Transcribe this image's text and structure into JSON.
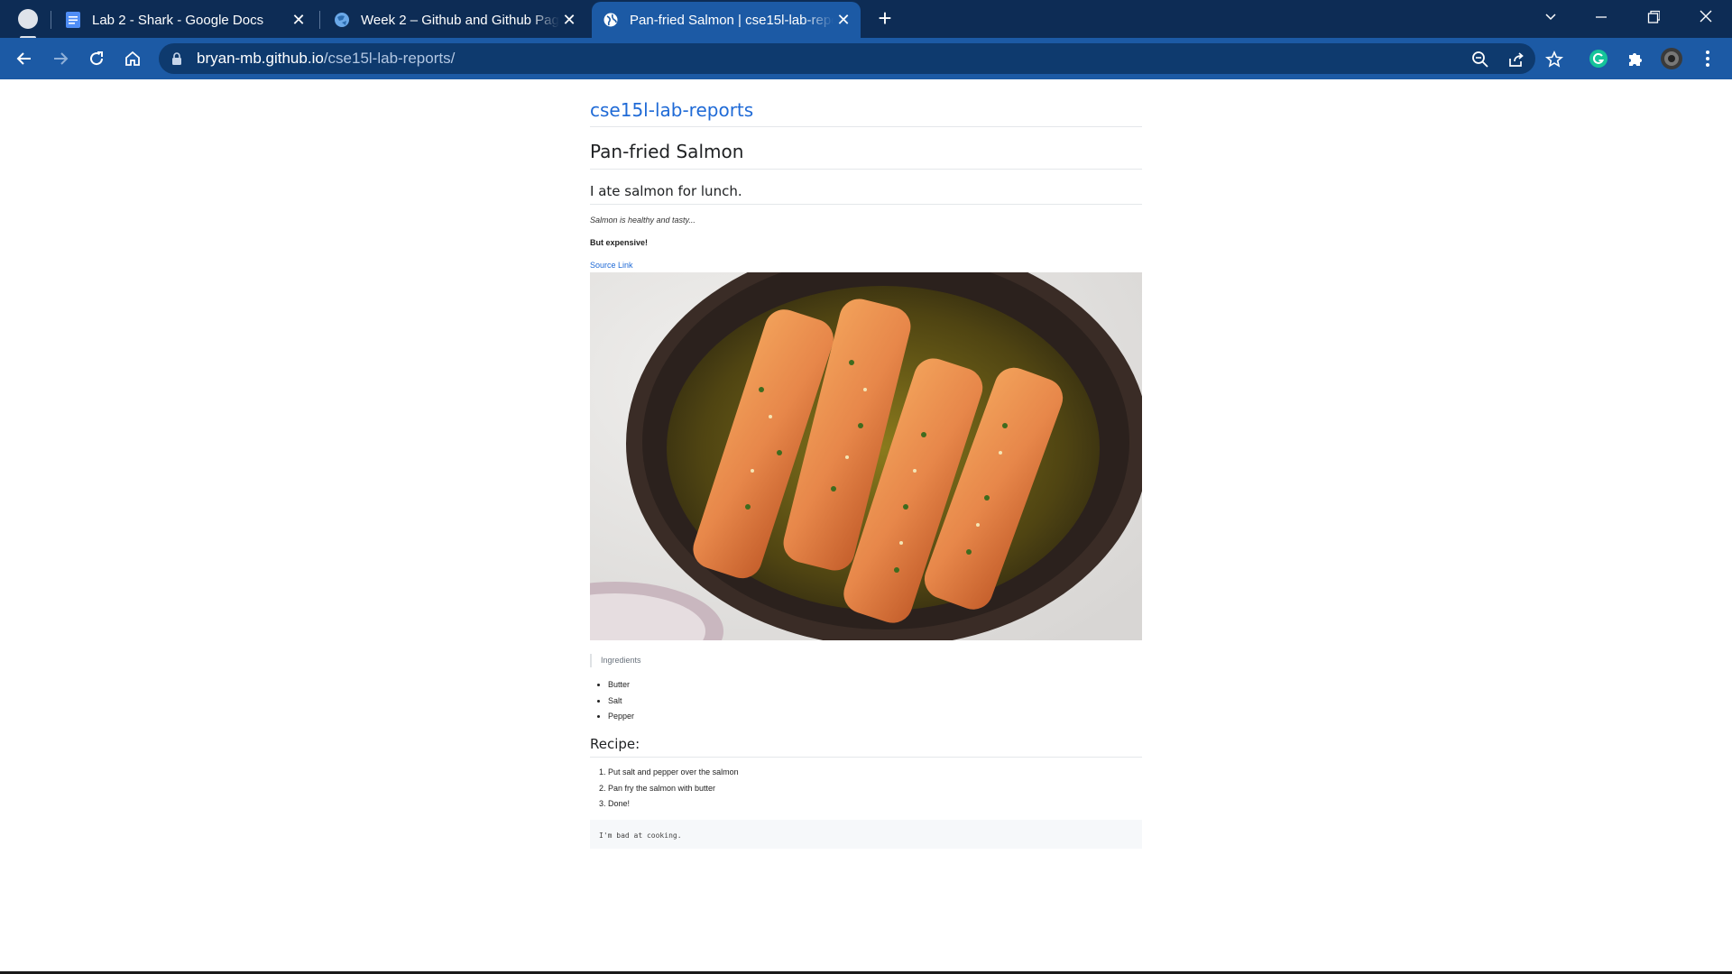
{
  "browser": {
    "tabs": [
      {
        "title": "Lab 2 - Shark - Google Docs",
        "favicon": "google-docs-icon"
      },
      {
        "title": "Week 2 – Github and Github Pages",
        "favicon": "globe-colored-icon"
      },
      {
        "title": "Pan-fried Salmon | cse15l-lab-reports",
        "favicon": "globe-icon",
        "active": true
      }
    ],
    "address": {
      "host": "bryan-mb.github.io",
      "path": "/cse15l-lab-reports/"
    },
    "colors": {
      "tabbar": "#0d2c55",
      "toolbar": "#1c5aa5",
      "omnibox": "#0e3a6e"
    }
  },
  "page": {
    "site_title": "cse15l-lab-reports",
    "heading": "Pan-fried Salmon",
    "subheading": "I ate salmon for lunch.",
    "italic_text": "Salmon is healthy and tasty...",
    "bold_text": "But expensive!",
    "source_link": "Source Link",
    "image_alt": "pan-fried salmon fillets in a skillet",
    "quote": "Ingredients",
    "ingredients": [
      "Butter",
      "Salt",
      "Pepper"
    ],
    "recipe_heading": "Recipe:",
    "steps": [
      "Put salt and pepper over the salmon",
      "Pan fry the salmon with butter",
      "Done!"
    ],
    "code": "I'm bad at cooking."
  }
}
